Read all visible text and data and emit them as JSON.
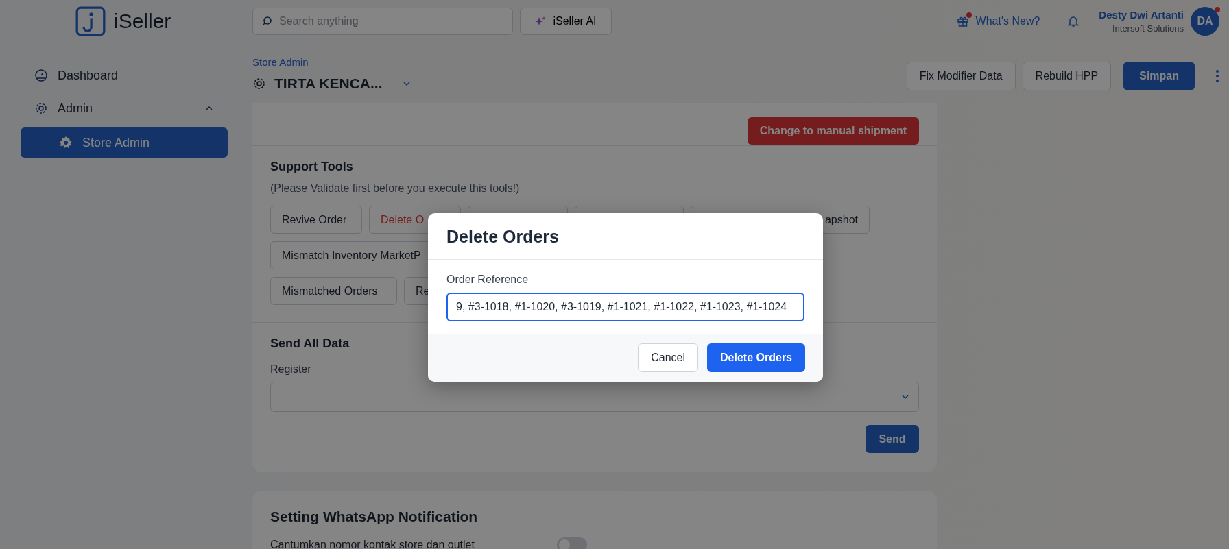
{
  "header": {
    "logo": "iSeller",
    "search": {
      "placeholder": "Search anything"
    },
    "ai_button": "iSeller AI",
    "whats_new": {
      "label": "What's New?",
      "has_dot": true
    },
    "user": {
      "name": "Desty Dwi Artanti",
      "company": "Intersoft Solutions",
      "initials": "DA",
      "has_dot": true
    }
  },
  "sidebar": {
    "items": [
      {
        "label": "Dashboard",
        "selected": false
      },
      {
        "label": "Admin",
        "selected": false,
        "expanded": true,
        "children": [
          {
            "label": "Store Admin",
            "selected": true
          }
        ]
      }
    ]
  },
  "page": {
    "breadcrumb": "Store Admin",
    "title": "TIRTA KENCA...",
    "actions": [
      {
        "label": "Fix Modifier Data",
        "kind": "outline"
      },
      {
        "label": "Rebuild HPP",
        "kind": "outline"
      },
      {
        "label": "Simpan",
        "kind": "primary"
      }
    ]
  },
  "shipment_button": "Change to manual shipment",
  "support_tools": {
    "title": "Support Tools",
    "note": "(Please Validate first before you execute this tools!)",
    "rows": [
      [
        {
          "label": "Revive Order",
          "kind": "normal"
        },
        {
          "label": "Delete O",
          "kind": "danger"
        },
        {
          "kind": "normal"
        },
        {
          "kind": "normal"
        },
        {
          "label": "apshot",
          "kind": "normal"
        }
      ],
      [
        {
          "label": "Mismatch Inventory MarketP",
          "kind": "normal"
        }
      ],
      [
        {
          "label": "Mismatched Orders",
          "kind": "normal"
        },
        {
          "label": "Re",
          "kind": "normal"
        }
      ]
    ]
  },
  "send_all_data": {
    "title": "Send All Data",
    "register_label": "Register",
    "button": "Send"
  },
  "whatsapp": {
    "title": "Setting WhatsApp Notification",
    "setting": {
      "label": "Cantumkan nomor kontak store dan outlet",
      "on": false
    }
  },
  "dialog": {
    "title": "Delete Orders",
    "field_label": "Order Reference",
    "field_value": "9, #3-1018, #1-1020, #3-1019, #1-1021, #1-1022, #1-1023, #1-1024",
    "buttons": [
      {
        "label": "Cancel",
        "kind": "secondary"
      },
      {
        "label": "Delete Orders",
        "kind": "primary"
      }
    ]
  }
}
